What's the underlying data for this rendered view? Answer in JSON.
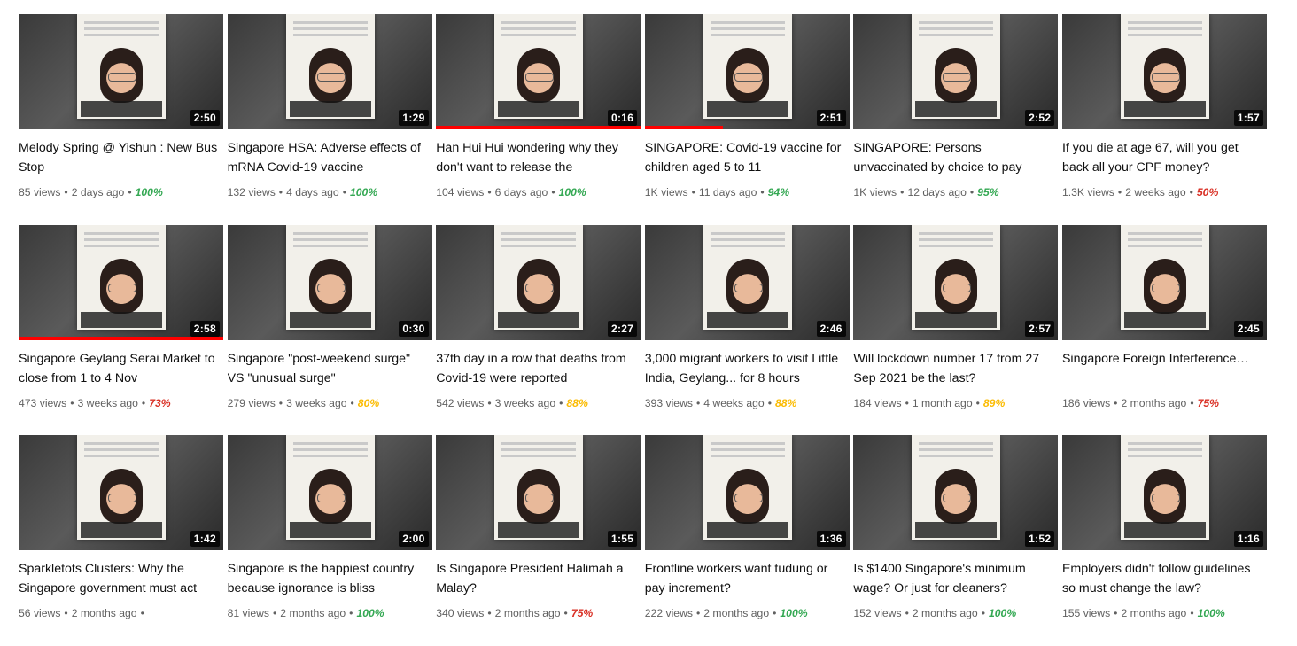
{
  "colors": {
    "green": "#34a853",
    "yellow": "#fbbc04",
    "red": "#d93025"
  },
  "videos": [
    {
      "title": "Melody Spring @ Yishun : New Bus Stop",
      "duration": "2:50",
      "views": "85 views",
      "age": "2 days ago",
      "rating": "100%",
      "rating_color": "#34a853",
      "watch_progress": 0
    },
    {
      "title": "Singapore HSA: Adverse effects of mRNA Covid-19 vaccine",
      "duration": "1:29",
      "views": "132 views",
      "age": "4 days ago",
      "rating": "100%",
      "rating_color": "#34a853",
      "watch_progress": 0
    },
    {
      "title": "Han Hui Hui wondering why they don't want to release the",
      "duration": "0:16",
      "views": "104 views",
      "age": "6 days ago",
      "rating": "100%",
      "rating_color": "#34a853",
      "watch_progress": 100
    },
    {
      "title": "SINGAPORE: Covid-19 vaccine for children aged 5 to 11",
      "duration": "2:51",
      "views": "1K views",
      "age": "11 days ago",
      "rating": "94%",
      "rating_color": "#34a853",
      "watch_progress": 38
    },
    {
      "title": "SINGAPORE: Persons unvaccinated by choice to pay",
      "duration": "2:52",
      "views": "1K views",
      "age": "12 days ago",
      "rating": "95%",
      "rating_color": "#34a853",
      "watch_progress": 0
    },
    {
      "title": "If you die at age 67, will you get back all your CPF money?",
      "duration": "1:57",
      "views": "1.3K views",
      "age": "2 weeks ago",
      "rating": "50%",
      "rating_color": "#d93025",
      "watch_progress": 0
    },
    {
      "title": "Singapore Geylang Serai Market to close from 1 to 4 Nov",
      "duration": "2:58",
      "views": "473 views",
      "age": "3 weeks ago",
      "rating": "73%",
      "rating_color": "#d93025",
      "watch_progress": 100
    },
    {
      "title": "Singapore \"post-weekend surge\" VS \"unusual surge\"",
      "duration": "0:30",
      "views": "279 views",
      "age": "3 weeks ago",
      "rating": "80%",
      "rating_color": "#fbbc04",
      "watch_progress": 0
    },
    {
      "title": "37th day in a row that deaths from Covid-19 were reported",
      "duration": "2:27",
      "views": "542 views",
      "age": "3 weeks ago",
      "rating": "88%",
      "rating_color": "#fbbc04",
      "watch_progress": 0
    },
    {
      "title": "3,000 migrant workers to visit Little India, Geylang... for 8 hours",
      "duration": "2:46",
      "views": "393 views",
      "age": "4 weeks ago",
      "rating": "88%",
      "rating_color": "#fbbc04",
      "watch_progress": 0
    },
    {
      "title": "Will lockdown number 17 from 27 Sep 2021 be the last?",
      "duration": "2:57",
      "views": "184 views",
      "age": "1 month ago",
      "rating": "89%",
      "rating_color": "#fbbc04",
      "watch_progress": 0
    },
    {
      "title": "Singapore Foreign Interference…",
      "duration": "2:45",
      "views": "186 views",
      "age": "2 months ago",
      "rating": "75%",
      "rating_color": "#d93025",
      "watch_progress": 0
    },
    {
      "title": "Sparkletots Clusters: Why the Singapore government must act",
      "duration": "1:42",
      "views": "56 views",
      "age": "2 months ago",
      "rating": "",
      "rating_color": "#34a853",
      "watch_progress": 0
    },
    {
      "title": "Singapore is the happiest country because ignorance is bliss",
      "duration": "2:00",
      "views": "81 views",
      "age": "2 months ago",
      "rating": "100%",
      "rating_color": "#34a853",
      "watch_progress": 0
    },
    {
      "title": "Is Singapore President Halimah a Malay?",
      "duration": "1:55",
      "views": "340 views",
      "age": "2 months ago",
      "rating": "75%",
      "rating_color": "#d93025",
      "watch_progress": 0
    },
    {
      "title": "Frontline workers want tudung or pay increment?",
      "duration": "1:36",
      "views": "222 views",
      "age": "2 months ago",
      "rating": "100%",
      "rating_color": "#34a853",
      "watch_progress": 0
    },
    {
      "title": "Is $1400 Singapore's minimum wage? Or just for cleaners?",
      "duration": "1:52",
      "views": "152 views",
      "age": "2 months ago",
      "rating": "100%",
      "rating_color": "#34a853",
      "watch_progress": 0
    },
    {
      "title": "Employers didn't follow guidelines so must change the law?",
      "duration": "1:16",
      "views": "155 views",
      "age": "2 months ago",
      "rating": "100%",
      "rating_color": "#34a853",
      "watch_progress": 0
    }
  ]
}
